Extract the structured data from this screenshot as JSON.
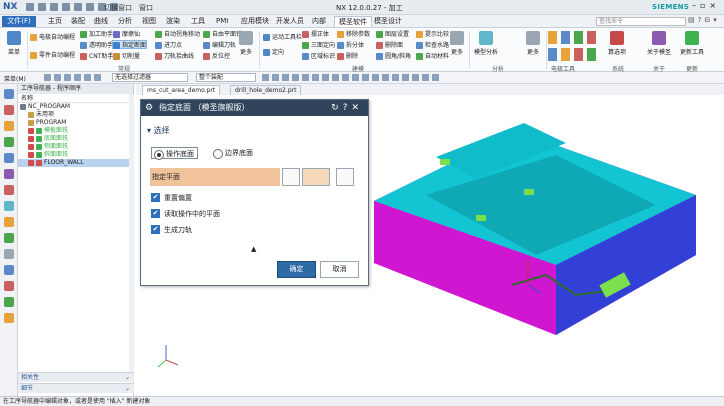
{
  "app": {
    "title": "NX 12.0.0.27 - 加工",
    "logo": "NX",
    "brand": "SIEMENS",
    "window_switch": "切换窗口",
    "window_menu": "窗口"
  },
  "tabs": [
    "文件(F)",
    "主页",
    "装配",
    "曲线",
    "分析",
    "视图",
    "渲染",
    "工具",
    "PMI",
    "应用模块",
    "开发人员",
    "内部",
    "模圣软件",
    "模圣设计"
  ],
  "search": {
    "placeholder": "查找命令"
  },
  "ribbon": {
    "big": [
      {
        "label": "菜单"
      }
    ],
    "col1": [
      "电极自动编程",
      "零件自动编程"
    ],
    "col2": [
      "加工助手",
      "透明助手",
      "CNT助手"
    ],
    "col3": [
      "摩擦仙",
      "指定断面",
      "切削量"
    ],
    "col4": [
      "自动拐角移动",
      "进刀点",
      "刀轨拾曲线"
    ],
    "col5": [
      "自由平面铣",
      "编辑刀轨",
      "反位控"
    ],
    "more1": "更多",
    "col6": [
      "运动工具栏",
      "定向"
    ],
    "col7": [
      "摆正体",
      "三面定向",
      "区域标识"
    ],
    "col8": [
      "移除参数",
      "拆分体",
      "删除"
    ],
    "col9": [
      "图层设置",
      "删除面",
      "圆角/斜角"
    ],
    "col10": [
      "提示比较",
      "检查水路",
      "自动材料"
    ],
    "more2": "更多",
    "col11": [
      "模型分析"
    ],
    "more3": "更多",
    "col12": [
      "算选项"
    ],
    "col13": [
      "关于模圣"
    ],
    "col14": [
      "更新工具"
    ],
    "groups": [
      "常规",
      "建模",
      "分析",
      "电极工具",
      "系统",
      "关于",
      "更新"
    ]
  },
  "toolbar": {
    "menu": "菜单(M)",
    "filter": "无选择过滤器",
    "assembly": "整个装配"
  },
  "navigator": {
    "title": "工序导航器 - 程序顺序",
    "column": "名称",
    "rows": [
      {
        "label": "NC_PROGRAM",
        "indent": 0,
        "icon": "#6d7a88"
      },
      {
        "label": "未用项",
        "indent": 1,
        "icon": "#c7a14a"
      },
      {
        "label": "PROGRAM",
        "indent": 1,
        "icon": "#c7a14a"
      },
      {
        "label": "模板面铣",
        "indent": 2,
        "icon": "#3fb34f"
      },
      {
        "label": "底面面铣",
        "indent": 2,
        "icon": "#3fb34f"
      },
      {
        "label": "侧面面铣",
        "indent": 2,
        "icon": "#3fb34f"
      },
      {
        "label": "斜面面铣",
        "indent": 2,
        "icon": "#3fb34f"
      },
      {
        "label": "FLOOR_WALL",
        "indent": 2,
        "icon": "#d24a4a",
        "highlight": true
      }
    ],
    "related": "相关性",
    "details": "细节"
  },
  "docs": [
    "ms_cut_area_demo.prt",
    "drill_hole_demo2.prt"
  ],
  "dialog": {
    "title": "指定底面 （模圣旗舰版）",
    "section": "选择",
    "radio1": "操作底面",
    "radio2": "边界底面",
    "spec": "指定平面",
    "check1": "重置偏置",
    "check2": "读取操作中的平面",
    "check3": "生成刀轨",
    "ok": "确定",
    "cancel": "取消"
  },
  "status": "在工序导航器中编辑对象，或者是使用 \"插入\" 新建对象"
}
